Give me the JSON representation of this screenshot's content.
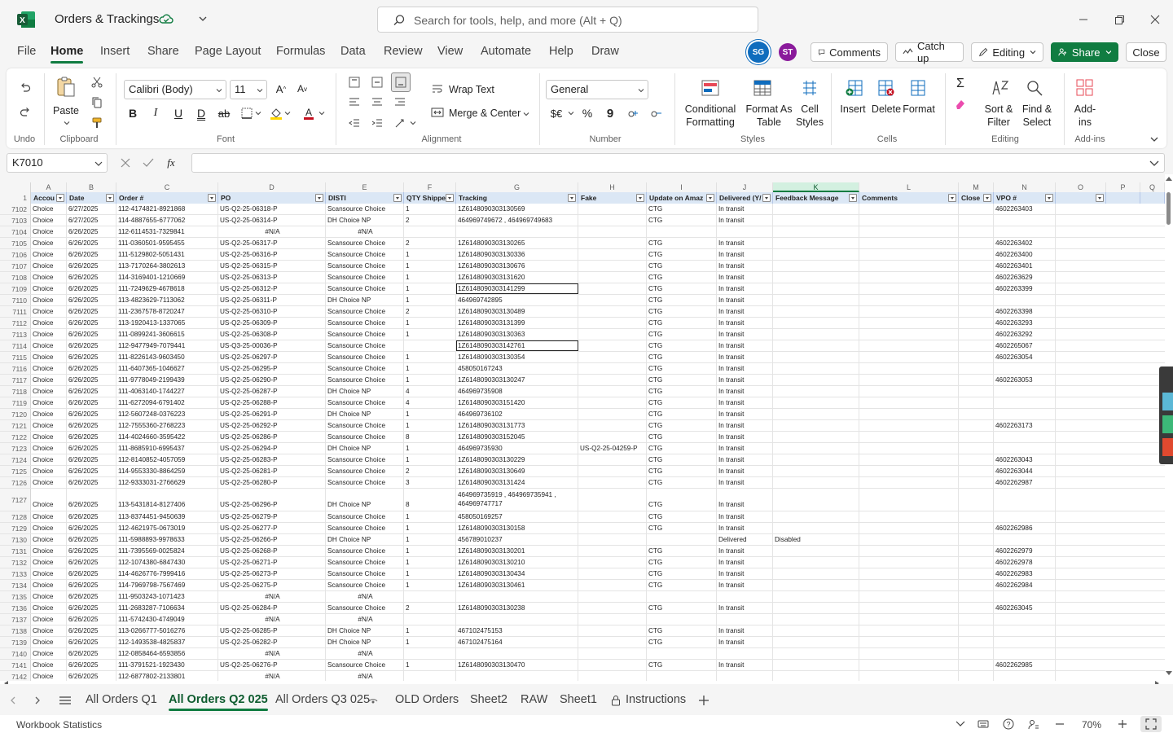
{
  "app": {
    "title": "Orders & Trackings",
    "search_placeholder": "Search for tools, help, and more (Alt + Q)",
    "accent": "#107c41"
  },
  "menu": [
    "File",
    "Home",
    "Insert",
    "Share",
    "Page Layout",
    "Formulas",
    "Data",
    "Review",
    "View",
    "Automate",
    "Help",
    "Draw"
  ],
  "menu_active": "Home",
  "avatars": [
    {
      "initials": "SG",
      "color": "#0f6cbd"
    },
    {
      "initials": "ST",
      "color": "#8a1a9b"
    }
  ],
  "actions": {
    "comments": "Comments",
    "catch_up": "Catch up",
    "editing": "Editing",
    "share": "Share",
    "close": "Close"
  },
  "ribbon": {
    "undo_label": "Undo",
    "paste": "Paste",
    "clipboard": "Clipboard",
    "font_name": "Calibri (Body)",
    "font_size": "11",
    "font": "Font",
    "wrap_text": "Wrap Text",
    "merge_center": "Merge & Center",
    "alignment": "Alignment",
    "number_format": "General",
    "number": "Number",
    "conditional_formatting": "Conditional Formatting",
    "format_as_table": "Format As Table",
    "cell_styles": "Cell Styles",
    "styles": "Styles",
    "insert": "Insert",
    "delete": "Delete",
    "format": "Format",
    "cells": "Cells",
    "sort_filter": "Sort & Filter",
    "find_select": "Find & Select",
    "editing": "Editing",
    "addins": "Add-ins",
    "addins_group": "Add-ins"
  },
  "formula_bar": {
    "name_box": "K7010",
    "formula": ""
  },
  "columns": [
    {
      "letter": "A",
      "header": "Accou"
    },
    {
      "letter": "B",
      "header": "Date"
    },
    {
      "letter": "C",
      "header": "Order #"
    },
    {
      "letter": "D",
      "header": "PO"
    },
    {
      "letter": "E",
      "header": "DISTI"
    },
    {
      "letter": "F",
      "header": "QTY Shippe"
    },
    {
      "letter": "G",
      "header": "Tracking"
    },
    {
      "letter": "H",
      "header": "Fake"
    },
    {
      "letter": "I",
      "header": "Update on Amaz"
    },
    {
      "letter": "J",
      "header": "Delivered (Y/"
    },
    {
      "letter": "K",
      "header": "Feedback Message"
    },
    {
      "letter": "L",
      "header": "Comments"
    },
    {
      "letter": "M",
      "header": "Close"
    },
    {
      "letter": "N",
      "header": "VPO #"
    },
    {
      "letter": "O",
      "header": ""
    },
    {
      "letter": "P",
      "header": ""
    },
    {
      "letter": "Q",
      "header": ""
    }
  ],
  "header_row_number": "1",
  "rows": [
    [
      "7102",
      "Choice",
      "6/27/2025",
      "112-4174821-8921868",
      "US-Q2-25-06318-P",
      "Scansource Choice",
      "1",
      "1Z6148090303130569",
      "",
      "CTG",
      "In transit",
      "",
      "",
      "",
      "4602263403"
    ],
    [
      "7103",
      "Choice",
      "6/27/2025",
      "114-4887655-6777062",
      "US-Q2-25-06314-P",
      "DH Choice NP",
      "2",
      "464969749672 , 464969749683",
      "",
      "CTG",
      "In transit",
      "",
      "",
      "",
      ""
    ],
    [
      "7104",
      "Choice",
      "6/26/2025",
      "112-6114531-7329841",
      "#N/A",
      "#N/A",
      "",
      "",
      "",
      "",
      "",
      "",
      "",
      "",
      ""
    ],
    [
      "7105",
      "Choice",
      "6/26/2025",
      "111-0360501-9595455",
      "US-Q2-25-06317-P",
      "Scansource Choice",
      "2",
      "1Z6148090303130265",
      "",
      "CTG",
      "In transit",
      "",
      "",
      "",
      "4602263402"
    ],
    [
      "7106",
      "Choice",
      "6/26/2025",
      "111-5129802-5051431",
      "US-Q2-25-06316-P",
      "Scansource Choice",
      "1",
      "1Z6148090303130336",
      "",
      "CTG",
      "In transit",
      "",
      "",
      "",
      "4602263400"
    ],
    [
      "7107",
      "Choice",
      "6/26/2025",
      "113-7170264-3802613",
      "US-Q2-25-06315-P",
      "Scansource Choice",
      "1",
      "1Z6148090303130676",
      "",
      "CTG",
      "In transit",
      "",
      "",
      "",
      "4602263401"
    ],
    [
      "7108",
      "Choice",
      "6/26/2025",
      "114-3169401-1210669",
      "US-Q2-25-06313-P",
      "Scansource Choice",
      "1",
      "1Z6148090303131620",
      "",
      "CTG",
      "In transit",
      "",
      "",
      "",
      "4602263629"
    ],
    [
      "7109",
      "Choice",
      "6/26/2025",
      "111-7249629-4678618",
      "US-Q2-25-06312-P",
      "Scansource Choice",
      "1",
      "1Z6148090303141299",
      "",
      "CTG",
      "In transit",
      "",
      "",
      "",
      "4602263399"
    ],
    [
      "7110",
      "Choice",
      "6/26/2025",
      "113-4823629-7113062",
      "US-Q2-25-06311-P",
      "DH Choice NP",
      "1",
      "464969742895",
      "",
      "CTG",
      "In transit",
      "",
      "",
      "",
      ""
    ],
    [
      "7111",
      "Choice",
      "6/26/2025",
      "111-2367578-8720247",
      "US-Q2-25-06310-P",
      "Scansource Choice",
      "2",
      "1Z6148090303130489",
      "",
      "CTG",
      "In transit",
      "",
      "",
      "",
      "4602263398"
    ],
    [
      "7112",
      "Choice",
      "6/26/2025",
      "113-1920413-1337065",
      "US-Q2-25-06309-P",
      "Scansource Choice",
      "1",
      "1Z6148090303131399",
      "",
      "CTG",
      "In transit",
      "",
      "",
      "",
      "4602263293"
    ],
    [
      "7113",
      "Choice",
      "6/26/2025",
      "111-0899241-3606615",
      "US-Q2-25-06308-P",
      "Scansource Choice",
      "1",
      "1Z6148090303130363",
      "",
      "CTG",
      "In transit",
      "",
      "",
      "",
      "4602263292"
    ],
    [
      "7114",
      "Choice",
      "6/26/2025",
      "112-9477949-7079441",
      "US-Q3-25-00036-P",
      "Scansource Choice",
      "",
      "1Z6148090303142761",
      "",
      "CTG",
      "In transit",
      "",
      "",
      "",
      "4602265067"
    ],
    [
      "7115",
      "Choice",
      "6/26/2025",
      "111-8226143-9603450",
      "US-Q2-25-06297-P",
      "Scansource Choice",
      "1",
      "1Z6148090303130354",
      "",
      "CTG",
      "In transit",
      "",
      "",
      "",
      "4602263054"
    ],
    [
      "7116",
      "Choice",
      "6/26/2025",
      "111-6407365-1046627",
      "US-Q2-25-06295-P",
      "Scansource Choice",
      "1",
      "458050167243",
      "",
      "CTG",
      "In transit",
      "",
      "",
      "",
      ""
    ],
    [
      "7117",
      "Choice",
      "6/26/2025",
      "111-9778049-2199439",
      "US-Q2-25-06290-P",
      "Scansource Choice",
      "1",
      "1Z6148090303130247",
      "",
      "CTG",
      "In transit",
      "",
      "",
      "",
      "4602263053"
    ],
    [
      "7118",
      "Choice",
      "6/26/2025",
      "111-4063140-1744227",
      "US-Q2-25-06287-P",
      "DH Choice NP",
      "4",
      "464969735908",
      "",
      "CTG",
      "In transit",
      "",
      "",
      "",
      ""
    ],
    [
      "7119",
      "Choice",
      "6/26/2025",
      "111-6272094-6791402",
      "US-Q2-25-06288-P",
      "Scansource Choice",
      "4",
      "1Z6148090303151420",
      "",
      "CTG",
      "In transit",
      "",
      "",
      "",
      ""
    ],
    [
      "7120",
      "Choice",
      "6/26/2025",
      "112-5607248-0376223",
      "US-Q2-25-06291-P",
      "DH Choice NP",
      "1",
      "464969736102",
      "",
      "CTG",
      "In transit",
      "",
      "",
      "",
      ""
    ],
    [
      "7121",
      "Choice",
      "6/26/2025",
      "112-7555360-2768223",
      "US-Q2-25-06292-P",
      "Scansource Choice",
      "1",
      "1Z6148090303131773",
      "",
      "CTG",
      "In transit",
      "",
      "",
      "",
      "4602263173"
    ],
    [
      "7122",
      "Choice",
      "6/26/2025",
      "114-4024660-3595422",
      "US-Q2-25-06286-P",
      "Scansource Choice",
      "8",
      "1Z6148090303152045",
      "",
      "CTG",
      "In transit",
      "",
      "",
      "",
      ""
    ],
    [
      "7123",
      "Choice",
      "6/26/2025",
      "111-8685910-6995437",
      "US-Q2-25-06294-P",
      "DH Choice NP",
      "1",
      "464969735930",
      "US-Q2-25-04259-P",
      "CTG",
      "In transit",
      "",
      "",
      "",
      ""
    ],
    [
      "7124",
      "Choice",
      "6/26/2025",
      "112-8140852-4057059",
      "US-Q2-25-06283-P",
      "Scansource Choice",
      "1",
      "1Z6148090303130229",
      "",
      "CTG",
      "In transit",
      "",
      "",
      "",
      "4602263043"
    ],
    [
      "7125",
      "Choice",
      "6/26/2025",
      "114-9553330-8864259",
      "US-Q2-25-06281-P",
      "Scansource Choice",
      "2",
      "1Z6148090303130649",
      "",
      "CTG",
      "In transit",
      "",
      "",
      "",
      "4602263044"
    ],
    [
      "7126",
      "Choice",
      "6/26/2025",
      "112-9333031-2766629",
      "US-Q2-25-06280-P",
      "Scansource Choice",
      "3",
      "1Z6148090303131424",
      "",
      "CTG",
      "In transit",
      "",
      "",
      "",
      "4602262987"
    ],
    [
      "7127",
      "Choice",
      "6/26/2025",
      "113-5431814-8127406",
      "US-Q2-25-06296-P",
      "DH Choice NP",
      "8",
      "464969735919 , 464969735941 , 464969747717",
      "",
      "CTG",
      "In transit",
      "",
      "",
      "",
      ""
    ],
    [
      "7128",
      "Choice",
      "6/26/2025",
      "113-8374451-9450639",
      "US-Q2-25-06279-P",
      "Scansource Choice",
      "1",
      "458050169257",
      "",
      "CTG",
      "In transit",
      "",
      "",
      "",
      ""
    ],
    [
      "7129",
      "Choice",
      "6/26/2025",
      "112-4621975-0673019",
      "US-Q2-25-06277-P",
      "Scansource Choice",
      "1",
      "1Z6148090303130158",
      "",
      "CTG",
      "In transit",
      "",
      "",
      "",
      "4602262986"
    ],
    [
      "7130",
      "Choice",
      "6/26/2025",
      "111-5988893-9978633",
      "US-Q2-25-06266-P",
      "DH Choice NP",
      "1",
      "456789010237",
      "",
      "",
      "Delivered",
      "Disabled",
      "",
      "",
      ""
    ],
    [
      "7131",
      "Choice",
      "6/26/2025",
      "111-7395569-0025824",
      "US-Q2-25-06268-P",
      "Scansource Choice",
      "1",
      "1Z6148090303130201",
      "",
      "CTG",
      "In transit",
      "",
      "",
      "",
      "4602262979"
    ],
    [
      "7132",
      "Choice",
      "6/26/2025",
      "112-1074380-6847430",
      "US-Q2-25-06271-P",
      "Scansource Choice",
      "1",
      "1Z6148090303130210",
      "",
      "CTG",
      "In transit",
      "",
      "",
      "",
      "4602262978"
    ],
    [
      "7133",
      "Choice",
      "6/26/2025",
      "114-4626776-7999416",
      "US-Q2-25-06273-P",
      "Scansource Choice",
      "1",
      "1Z6148090303130434",
      "",
      "CTG",
      "In transit",
      "",
      "",
      "",
      "4602262983"
    ],
    [
      "7134",
      "Choice",
      "6/26/2025",
      "114-7969798-7567469",
      "US-Q2-25-06275-P",
      "Scansource Choice",
      "1",
      "1Z6148090303130461",
      "",
      "CTG",
      "In transit",
      "",
      "",
      "",
      "4602262984"
    ],
    [
      "7135",
      "Choice",
      "6/26/2025",
      "111-9503243-1071423",
      "#N/A",
      "#N/A",
      "",
      "",
      "",
      "",
      "",
      "",
      "",
      "",
      ""
    ],
    [
      "7136",
      "Choice",
      "6/26/2025",
      "111-2683287-7106634",
      "US-Q2-25-06284-P",
      "Scansource Choice",
      "2",
      "1Z6148090303130238",
      "",
      "CTG",
      "In transit",
      "",
      "",
      "",
      "4602263045"
    ],
    [
      "7137",
      "Choice",
      "6/26/2025",
      "111-5742430-4749049",
      "#N/A",
      "#N/A",
      "",
      "",
      "",
      "",
      "",
      "",
      "",
      "",
      ""
    ],
    [
      "7138",
      "Choice",
      "6/26/2025",
      "113-0266777-5016276",
      "US-Q2-25-06285-P",
      "DH Choice NP",
      "1",
      "467102475153",
      "",
      "CTG",
      "In transit",
      "",
      "",
      "",
      ""
    ],
    [
      "7139",
      "Choice",
      "6/26/2025",
      "112-1493538-4825837",
      "US-Q2-25-06282-P",
      "DH Choice NP",
      "1",
      "467102475164",
      "",
      "CTG",
      "In transit",
      "",
      "",
      "",
      ""
    ],
    [
      "7140",
      "Choice",
      "6/26/2025",
      "112-0858464-6593856",
      "#N/A",
      "#N/A",
      "",
      "",
      "",
      "",
      "",
      "",
      "",
      "",
      ""
    ],
    [
      "7141",
      "Choice",
      "6/26/2025",
      "111-3791521-1923430",
      "US-Q2-25-06276-P",
      "Scansource Choice",
      "1",
      "1Z6148090303130470",
      "",
      "CTG",
      "In transit",
      "",
      "",
      "",
      "4602262985"
    ],
    [
      "7142",
      "Choice",
      "6/26/2025",
      "112-6877802-2133801",
      "#N/A",
      "#N/A",
      "",
      "",
      "",
      "",
      "",
      "",
      "",
      "",
      ""
    ]
  ],
  "sheet_tabs": [
    "All Orders Q1",
    "All Orders Q2 025",
    "All Orders Q3 025",
    "OLD Orders",
    "Sheet2",
    "RAW",
    "Sheet1",
    "Instructions"
  ],
  "active_tab": "All Orders Q2 025",
  "status": {
    "left": "Workbook Statistics",
    "zoom": "70%"
  }
}
